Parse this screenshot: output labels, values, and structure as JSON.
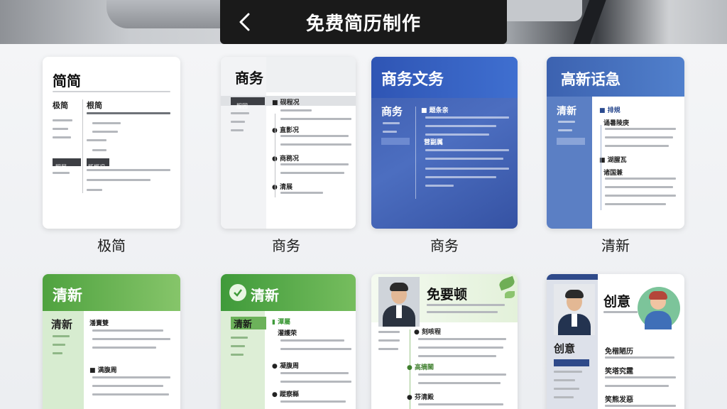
{
  "header": {
    "title": "免费简历制作",
    "back_icon": "chevron-left-icon"
  },
  "templates": [
    {
      "label": "极简",
      "doc_title": "简简",
      "side_heading": "极简",
      "main_heading": "根简",
      "tag_left": "照展",
      "tag_right": "既概况"
    },
    {
      "label": "商务",
      "doc_title": "商务",
      "tag": "服园",
      "section1": "■ 砚程况",
      "section2": "● 直影况",
      "section3": "● 商務况",
      "section4": "● 清展"
    },
    {
      "label": "商务",
      "doc_title": "商务文务",
      "side_heading": "商务",
      "section1": "■ 题条亲",
      "section2": "营副属",
      "accent": "#3f5fae"
    },
    {
      "label": "清新",
      "doc_title": "高新话急",
      "side_heading": "清新",
      "section1": "■ 排規",
      "section2": "诵暑陵庚",
      "section3": "■ 湖腥瓦",
      "section4": "诸国兼",
      "accent": "#4670b8"
    },
    {
      "doc_title": "清新",
      "side_heading": "清新",
      "section1": "潘賣雙",
      "section2": "■ 满腹周",
      "accent": "#5aa54a"
    },
    {
      "doc_title": "清新",
      "side_heading": "清新",
      "section1": "▮ 潭屬",
      "section2": "濯護荣",
      "section3": "● 凝腹周",
      "section4": "● 蹤察縣",
      "accent": "#4d9c45"
    },
    {
      "doc_title": "免要顿",
      "section1": "● 刻咳程",
      "section2": "● 高摘閣",
      "section3": "● 芬清殿",
      "accent": "#6fae56"
    },
    {
      "doc_title": "创意",
      "side_heading": "创意",
      "section1": "免楷陋历",
      "section2": "笑塔究霆",
      "section3": "笑熊发惡",
      "accent": "#2f4a8a"
    }
  ]
}
